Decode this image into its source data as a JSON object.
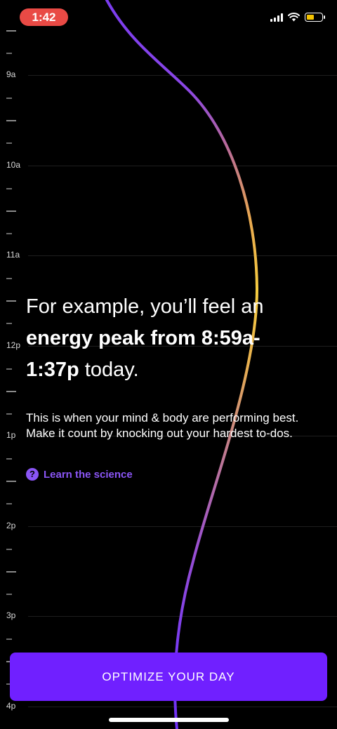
{
  "status_bar": {
    "time": "1:42"
  },
  "timeline": {
    "hours": [
      "9a",
      "10a",
      "11a",
      "12p",
      "1p",
      "2p",
      "3p",
      "4p"
    ]
  },
  "content": {
    "headline_intro": "For example, you’ll feel an ",
    "headline_bold": "energy peak from 8:59a-1:37p",
    "headline_end": " today.",
    "body": "This is when your mind & body are performing best. Make it count by knocking out your hardest to-dos.",
    "learn_link": "Learn the science",
    "help_glyph": "?"
  },
  "cta": {
    "label": "OPTIMIZE YOUR DAY"
  },
  "colors": {
    "accent": "#7020ff",
    "link": "#8a55f5",
    "curve_peak": "#f5c84a",
    "curve_low": "#7a3cf0",
    "time_pill": "#e94a45"
  }
}
